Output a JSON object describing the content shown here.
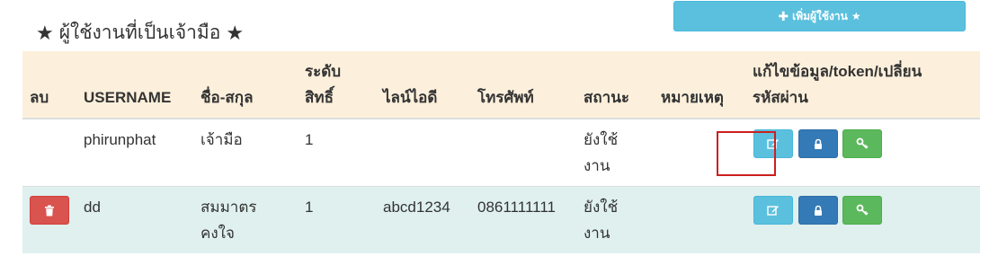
{
  "page": {
    "title_star_icon": "star-icon",
    "title": "ผู้ใช้งานที่เป็นเจ้ามือ",
    "add_button_label": "เพิ่มผู้ใช้งาน",
    "add_button_icon": "plus-icon"
  },
  "table": {
    "headers": {
      "delete": "ลบ",
      "username": "USERNAME",
      "fullname": "ชื่อ-สกุล",
      "level_1": "ระดับ",
      "level_2": "สิทธิ์",
      "line_id": "ไลน์ไอดี",
      "phone": "โทรศัพท์",
      "status": "สถานะ",
      "note": "หมายเหตุ",
      "actions_1": "แก้ไขข้อมูล/token/เปลี่ยน",
      "actions_2": "รหัสผ่าน"
    },
    "rows": [
      {
        "username": "phirunphat",
        "fullname_1": "เจ้ามือ",
        "fullname_2": "",
        "level": "1",
        "line_id": "",
        "phone": "",
        "status_1": "ยังใช้",
        "status_2": "งาน",
        "note": ""
      },
      {
        "username": "dd",
        "fullname_1": "สมมาตร",
        "fullname_2": "คงใจ",
        "level": "1",
        "line_id": "abcd1234",
        "phone": "0861111111",
        "status_1": "ยังใช้",
        "status_2": "งาน",
        "note": ""
      }
    ]
  },
  "icons": {
    "delete": "trash-icon",
    "edit": "edit-icon",
    "token": "lock-icon",
    "password": "key-icon"
  },
  "colors": {
    "info": "#5bc0de",
    "primary": "#337ab7",
    "success": "#5cb85c",
    "danger": "#d9534f",
    "header_bg": "#fcf0dc",
    "row_highlight_bg": "#dff0ef",
    "annotation_box": "#cc1f1f"
  }
}
